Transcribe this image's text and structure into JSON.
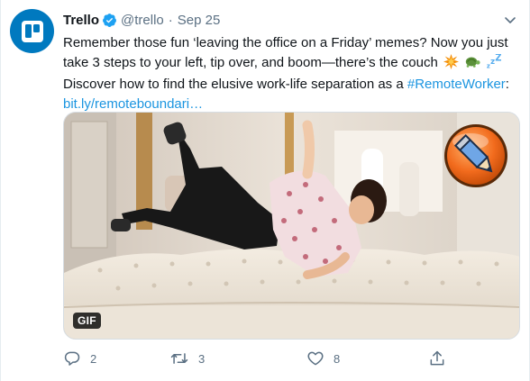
{
  "tweet": {
    "display_name": "Trello",
    "handle": "@trello",
    "separator": "·",
    "date": "Sep 25",
    "text_line1": "Remember those fun ‘leaving the office on a Friday’ memes? Now you just",
    "text_line2": "take 3 steps to your left, tip over, and boom—there’s the couch",
    "text_line3_prefix": "Discover how to find the elusive work-life separation as a ",
    "hashtag": "#RemoteWorker",
    "text_line3_suffix": ":",
    "link": "bit.ly/remoteboundari…",
    "media_badge": "GIF",
    "actions": {
      "reply_count": "2",
      "retweet_count": "3",
      "like_count": "8"
    }
  },
  "colors": {
    "brand_avatar": "#0079bf",
    "verified": "#1da1f2",
    "link": "#1b95e0",
    "secondary_text": "#5b7083"
  },
  "icons": [
    "trello-logo-icon",
    "verified-badge-icon",
    "more-options-icon",
    "collision-emoji-icon",
    "turtle-emoji-icon",
    "zzz-emoji-icon",
    "edit-pencil-icon",
    "reply-icon",
    "retweet-icon",
    "like-icon",
    "share-icon"
  ]
}
